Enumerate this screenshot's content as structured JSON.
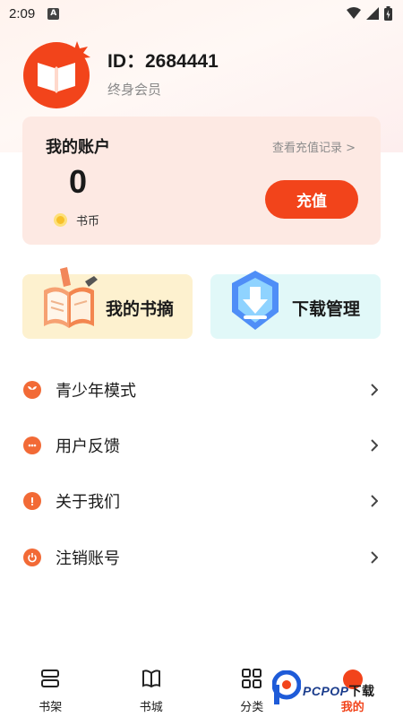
{
  "status_bar": {
    "time": "2:09",
    "a_badge": "A"
  },
  "profile": {
    "id_text": "ID：2684441",
    "membership": "终身会员"
  },
  "account": {
    "title": "我的账户",
    "recharge_record": "查看充值记录 >",
    "balance": "0",
    "coin_label": "书币",
    "recharge_button": "充值"
  },
  "features": [
    {
      "label": "我的书摘",
      "icon": "open-book-pen-icon"
    },
    {
      "label": "下载管理",
      "icon": "download-shield-icon"
    }
  ],
  "menu": [
    {
      "label": "青少年模式",
      "icon": "sprout-icon"
    },
    {
      "label": "用户反馈",
      "icon": "chat-icon"
    },
    {
      "label": "关于我们",
      "icon": "info-icon"
    },
    {
      "label": "注销账号",
      "icon": "power-icon"
    }
  ],
  "tabs": [
    {
      "label": "书架",
      "icon": "bookshelf-icon",
      "active": false
    },
    {
      "label": "书城",
      "icon": "book-icon",
      "active": false
    },
    {
      "label": "分类",
      "icon": "grid-icon",
      "active": false
    },
    {
      "label": "我的",
      "icon": "profile-dot-icon",
      "active": true
    }
  ],
  "watermark": {
    "brand": "PCPOP",
    "suffix": "下载"
  },
  "colors": {
    "accent": "#f2441b",
    "card_bg": "#fde9e3",
    "notes_bg": "#fdf1cf",
    "download_bg": "#e1f8f8"
  }
}
